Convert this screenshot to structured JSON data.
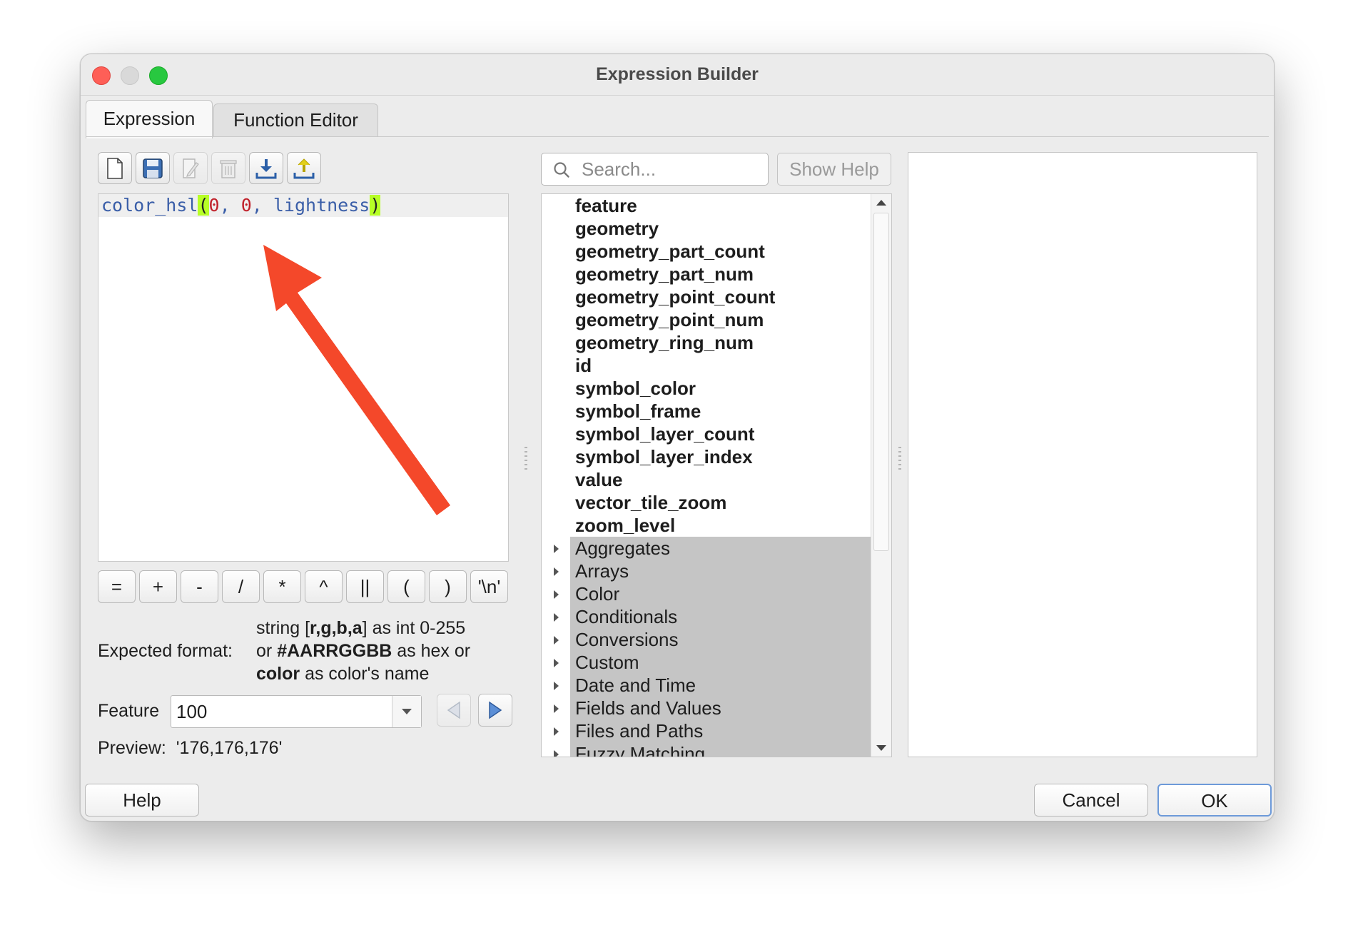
{
  "window": {
    "title": "Expression Builder"
  },
  "tabs": [
    {
      "label": "Expression",
      "active": true
    },
    {
      "label": "Function Editor",
      "active": false
    }
  ],
  "toolbar": {
    "icons": [
      "new-file-icon",
      "save-icon",
      "edit-icon",
      "delete-icon",
      "import-icon",
      "export-icon"
    ]
  },
  "editor": {
    "fn": "color_hsl",
    "open_paren": "(",
    "arg1": "0",
    "sep1": ", ",
    "arg2": "0",
    "sep2": ", ",
    "arg3": "lightness",
    "close_paren": ")"
  },
  "operators": [
    "=",
    "+",
    "-",
    "/",
    "*",
    "^",
    "||",
    "(",
    ")",
    "'\\n'"
  ],
  "expected_format": {
    "label": "Expected format:",
    "line1_pre": "string [",
    "line1_bold": "r,g,b,a",
    "line1_post": "] as int 0-255",
    "line2_pre": "or ",
    "line2_bold": "#AARRGGBB",
    "line2_post": " as hex or",
    "line3_bold": "color",
    "line3_post": " as color's name"
  },
  "feature": {
    "label": "Feature",
    "value": "100"
  },
  "preview": {
    "label": "Preview:",
    "value": "'176,176,176'"
  },
  "search": {
    "placeholder": "Search..."
  },
  "show_help_label": "Show Help",
  "tree": {
    "variables": [
      "feature",
      "geometry",
      "geometry_part_count",
      "geometry_part_num",
      "geometry_point_count",
      "geometry_point_num",
      "geometry_ring_num",
      "id",
      "symbol_color",
      "symbol_frame",
      "symbol_layer_count",
      "symbol_layer_index",
      "value",
      "vector_tile_zoom",
      "zoom_level"
    ],
    "groups": [
      "Aggregates",
      "Arrays",
      "Color",
      "Conditionals",
      "Conversions",
      "Custom",
      "Date and Time",
      "Fields and Values",
      "Files and Paths",
      "Fuzzy Matching"
    ]
  },
  "buttons": {
    "help": "Help",
    "cancel": "Cancel",
    "ok": "OK"
  },
  "colors": {
    "annotation_arrow": "#f4482a",
    "paren_highlight": "#b7ff26",
    "group_bg": "#c5c5c5"
  }
}
